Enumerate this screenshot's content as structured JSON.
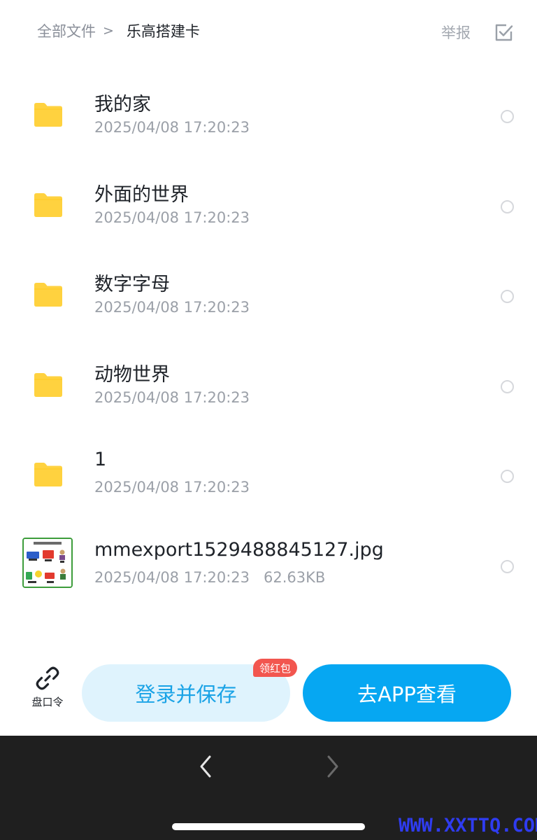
{
  "header": {
    "breadcrumb_root": "全部文件",
    "breadcrumb_separator": ">",
    "breadcrumb_current": "乐高搭建卡",
    "report_label": "举报",
    "select_icon": "checkbox-icon"
  },
  "files": [
    {
      "name": "我的家",
      "date": "2025/04/08 17:20:23",
      "size": "",
      "type": "folder"
    },
    {
      "name": "外面的世界",
      "date": "2025/04/08 17:20:23",
      "size": "",
      "type": "folder"
    },
    {
      "name": "数字字母",
      "date": "2025/04/08 17:20:23",
      "size": "",
      "type": "folder"
    },
    {
      "name": "动物世界",
      "date": "2025/04/08 17:20:23",
      "size": "",
      "type": "folder"
    },
    {
      "name": "1",
      "date": "2025/04/08 17:20:23",
      "size": "",
      "type": "folder"
    },
    {
      "name": "mmexport1529488845127.jpg",
      "date": "2025/04/08 17:20:23",
      "size": "62.63KB",
      "type": "image"
    }
  ],
  "actions": {
    "share_code_label": "盘口令",
    "login_save_label": "登录并保存",
    "badge_label": "领红包",
    "open_app_label": "去APP查看"
  },
  "browser": {
    "back_icon": "chevron-left-icon",
    "forward_icon": "chevron-right-icon"
  },
  "watermark": "WWW.XXTTQ.COM",
  "colors": {
    "folder": "#ffd23f",
    "primary": "#06a7f2",
    "login_bg": "#dff3fd",
    "badge": "#f2564f",
    "browser_bar": "#1f1f1f",
    "watermark": "#2f3cf0"
  }
}
